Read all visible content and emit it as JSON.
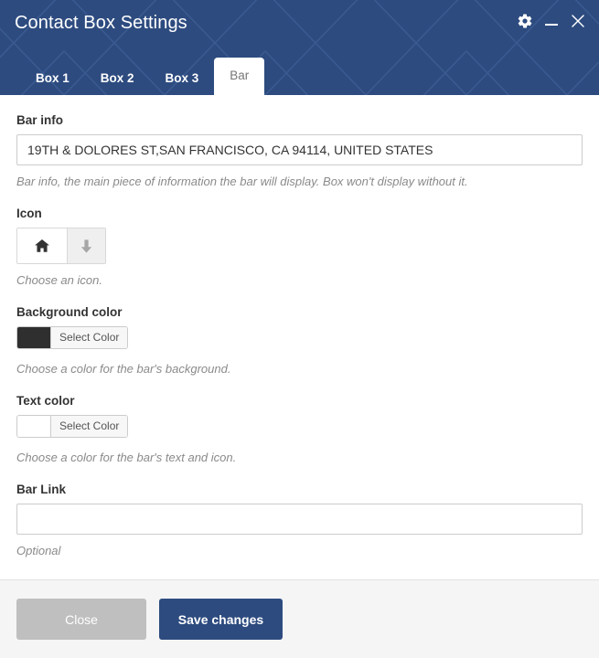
{
  "window": {
    "title": "Contact Box Settings",
    "controls": [
      {
        "name": "settings-gear",
        "icon": "gear-icon",
        "label": "Settings"
      },
      {
        "name": "minimize",
        "icon": "minimize-icon",
        "label": "Minimize"
      },
      {
        "name": "close",
        "icon": "close-icon",
        "label": "Close"
      }
    ],
    "header_color": "#2d4b7f"
  },
  "tabs": [
    {
      "label": "Box 1",
      "active": false
    },
    {
      "label": "Box 2",
      "active": false
    },
    {
      "label": "Box 3",
      "active": false
    },
    {
      "label": "Bar",
      "active": true
    }
  ],
  "fields": {
    "bar_info": {
      "label": "Bar info",
      "value": "19TH & DOLORES ST,SAN FRANCISCO, CA 94114, UNITED STATES",
      "placeholder": "",
      "help": "Bar info, the main piece of information the bar will display. Box won't display without it."
    },
    "icon": {
      "label": "Icon",
      "selected_icon": "home-icon",
      "dropdown_icon": "arrow-down-icon",
      "help": "Choose an icon."
    },
    "background_color": {
      "label": "Background color",
      "swatch": "#2f2f2f",
      "button_label": "Select Color",
      "help": "Choose a color for the bar's background."
    },
    "text_color": {
      "label": "Text color",
      "swatch": "#ffffff",
      "button_label": "Select Color",
      "help": "Choose a color for the bar's text and icon."
    },
    "bar_link": {
      "label": "Bar Link",
      "value": "",
      "placeholder": "",
      "help": "Optional"
    }
  },
  "footer": {
    "close_label": "Close",
    "save_label": "Save changes",
    "close_color": "#bfbfbf",
    "save_color": "#2d4b7f"
  }
}
